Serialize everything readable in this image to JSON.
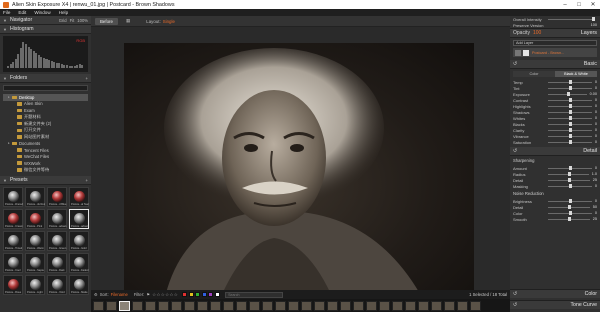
{
  "window": {
    "title": "Alien Skin Exposure X4 | renwu_01.jpg | Postcard - Brown Shadows",
    "minimize": "–",
    "maximize": "□",
    "close": "✕"
  },
  "menu": [
    "File",
    "Edit",
    "Window",
    "Help"
  ],
  "left": {
    "navigator": {
      "label": "Navigator",
      "fit": "Grid",
      "fill": "Fit",
      "zoom": "100%"
    },
    "histogram": {
      "label": "Histogram",
      "channel": "RGB"
    },
    "folders": {
      "label": "Folders",
      "items": [
        {
          "label": "Desktop",
          "indent": 1,
          "selected": true
        },
        {
          "label": "Alien Skin",
          "indent": 2,
          "selected": false
        },
        {
          "label": "Exam",
          "indent": 2,
          "selected": false
        },
        {
          "label": "开题材料",
          "indent": 2,
          "selected": false
        },
        {
          "label": "新建文件夹 (2)",
          "indent": 2,
          "selected": false
        },
        {
          "label": "打开文件",
          "indent": 2,
          "selected": false
        },
        {
          "label": "网站图片素材",
          "indent": 2,
          "selected": false
        },
        {
          "label": "Documents",
          "indent": 1,
          "selected": false
        },
        {
          "label": "Tencent Files",
          "indent": 2,
          "selected": false
        },
        {
          "label": "WeChat Files",
          "indent": 2,
          "selected": false
        },
        {
          "label": "WXWork",
          "indent": 2,
          "selected": false
        },
        {
          "label": "微信文件等待",
          "indent": 2,
          "selected": false
        }
      ]
    },
    "presets": {
      "label": "Presets",
      "items": [
        {
          "caption": "Postca...ithered",
          "tone": "gray",
          "selected": false
        },
        {
          "caption": "Postca...ds Red",
          "tone": "gray",
          "selected": false
        },
        {
          "caption": "Postca...d Blue",
          "tone": "red",
          "selected": false
        },
        {
          "caption": "Postca...al Teal",
          "tone": "red",
          "selected": false
        },
        {
          "caption": "Postca...Cream",
          "tone": "red",
          "selected": false
        },
        {
          "caption": "Postca...Pink",
          "tone": "red",
          "selected": false
        },
        {
          "caption": "Postca...adows",
          "tone": "gray",
          "selected": false
        },
        {
          "caption": "Postca...adows",
          "tone": "gray",
          "selected": true
        },
        {
          "caption": "Postca...Tinted",
          "tone": "gray",
          "selected": false
        },
        {
          "caption": "Postca...Warm",
          "tone": "gray",
          "selected": false
        },
        {
          "caption": "Postca...Green",
          "tone": "gray",
          "selected": false
        },
        {
          "caption": "Postca...Gold",
          "tone": "gray",
          "selected": false
        },
        {
          "caption": "Postca...Cool",
          "tone": "gray",
          "selected": false
        },
        {
          "caption": "Postca...Sepia",
          "tone": "gray",
          "selected": false
        },
        {
          "caption": "Postca...Dark",
          "tone": "gray",
          "selected": false
        },
        {
          "caption": "Postca...Faded",
          "tone": "gray",
          "selected": false
        },
        {
          "caption": "Postca...Rose",
          "tone": "red",
          "selected": false
        },
        {
          "caption": "Postca...Light",
          "tone": "gray",
          "selected": false
        },
        {
          "caption": "Postca...Vivid",
          "tone": "gray",
          "selected": false
        },
        {
          "caption": "Postca...Matte",
          "tone": "gray",
          "selected": false
        }
      ]
    }
  },
  "center": {
    "before_label": "Before",
    "layout_label": "Layout:",
    "layout_value": "Single",
    "sort_label": "Sort:",
    "sort_value": "Filename",
    "filter_label": "Filter:",
    "stars": "☆☆☆☆☆☆",
    "color_chips": [
      "#e03030",
      "#e0c020",
      "#30b030",
      "#3060e0",
      "#a040c0",
      "#ffffff"
    ],
    "search_placeholder": "Search",
    "count": "1 Selected / 18 Total",
    "filmstrip_count": 30,
    "filmstrip_selected": 2
  },
  "right": {
    "overall_intensity": {
      "label": "Overall Intensity",
      "value": "100"
    },
    "preserve_version": {
      "label": "Preserve Version",
      "value": "100"
    },
    "opacity": {
      "label": "Opacity",
      "value": "100"
    },
    "layers_label": "Layers",
    "add_layer": "Add Layer",
    "layer_name": "Postcard - Brown...",
    "basic_label": "Basic",
    "tabs": [
      "Color",
      "Black & White"
    ],
    "active_tab": 1,
    "basic_rows": [
      {
        "label": "Temp",
        "value": "0"
      },
      {
        "label": "Tint",
        "value": "0"
      },
      {
        "label": "Exposure",
        "value": "0.00"
      },
      {
        "label": "Contrast",
        "value": "0"
      },
      {
        "label": "Highlights",
        "value": "0"
      },
      {
        "label": "Shadows",
        "value": "0"
      },
      {
        "label": "Whites",
        "value": "0"
      },
      {
        "label": "Blacks",
        "value": "0"
      },
      {
        "label": "Clarity",
        "value": "0"
      },
      {
        "label": "Vibrance",
        "value": "0"
      },
      {
        "label": "Saturation",
        "value": "0"
      }
    ],
    "detail_label": "Detail",
    "sharpening_label": "Sharpening",
    "sharpening_rows": [
      {
        "label": "Amount",
        "value": "0"
      },
      {
        "label": "Radius",
        "value": "1.0"
      },
      {
        "label": "Detail",
        "value": "25"
      },
      {
        "label": "Masking",
        "value": "0"
      }
    ],
    "noise_label": "Noise Reduction",
    "noise_rows": [
      {
        "label": "Brightness",
        "value": "0"
      },
      {
        "label": "Detail",
        "value": "50"
      },
      {
        "label": "Color",
        "value": "0"
      },
      {
        "label": "Smooth",
        "value": "25"
      }
    ],
    "color_label": "Color",
    "tone_curve_label": "Tone Curve"
  }
}
